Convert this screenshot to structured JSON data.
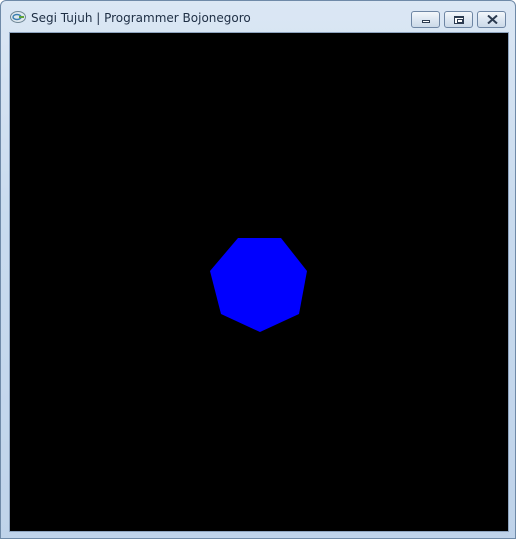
{
  "window": {
    "title": "Segi Tujuh | Programmer Bojonegoro",
    "icon": "opengl-app-icon",
    "controls": [
      "minimize",
      "maximize",
      "close"
    ]
  },
  "canvas": {
    "background_color": "#000000",
    "shape": {
      "type": "heptagon",
      "sides": 7,
      "fill_color": "#0000ff"
    }
  }
}
